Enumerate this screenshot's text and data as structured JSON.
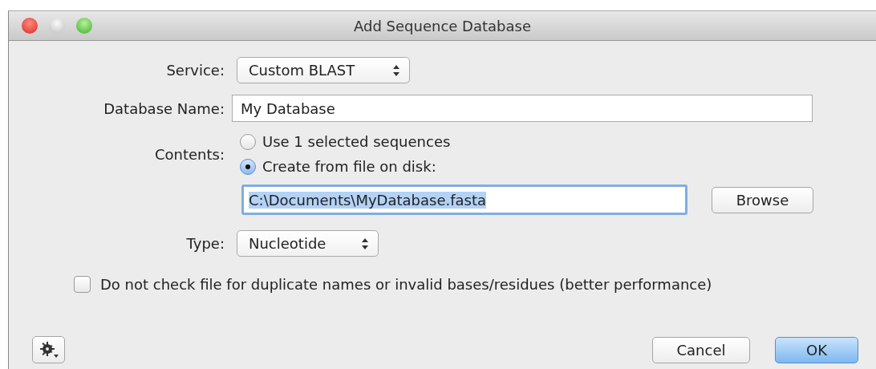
{
  "window": {
    "title": "Add Sequence Database"
  },
  "service": {
    "label": "Service:",
    "value": "Custom BLAST"
  },
  "database_name": {
    "label": "Database Name:",
    "value": "My Database"
  },
  "contents": {
    "label": "Contents:",
    "options": [
      {
        "label": "Use 1 selected sequences",
        "selected": false
      },
      {
        "label": "Create from file on disk:",
        "selected": true
      }
    ]
  },
  "file_path": {
    "value": "C:\\Documents\\MyDatabase.fasta",
    "focused": true,
    "text_selected": true
  },
  "browse_button": "Browse",
  "type": {
    "label": "Type:",
    "value": "Nucleotide"
  },
  "skip_check": {
    "label": "Do not check file for duplicate names or invalid bases/residues (better performance)",
    "checked": false
  },
  "buttons": [
    {
      "label": "Cancel",
      "default": false
    },
    {
      "label": "OK",
      "default": true
    }
  ]
}
